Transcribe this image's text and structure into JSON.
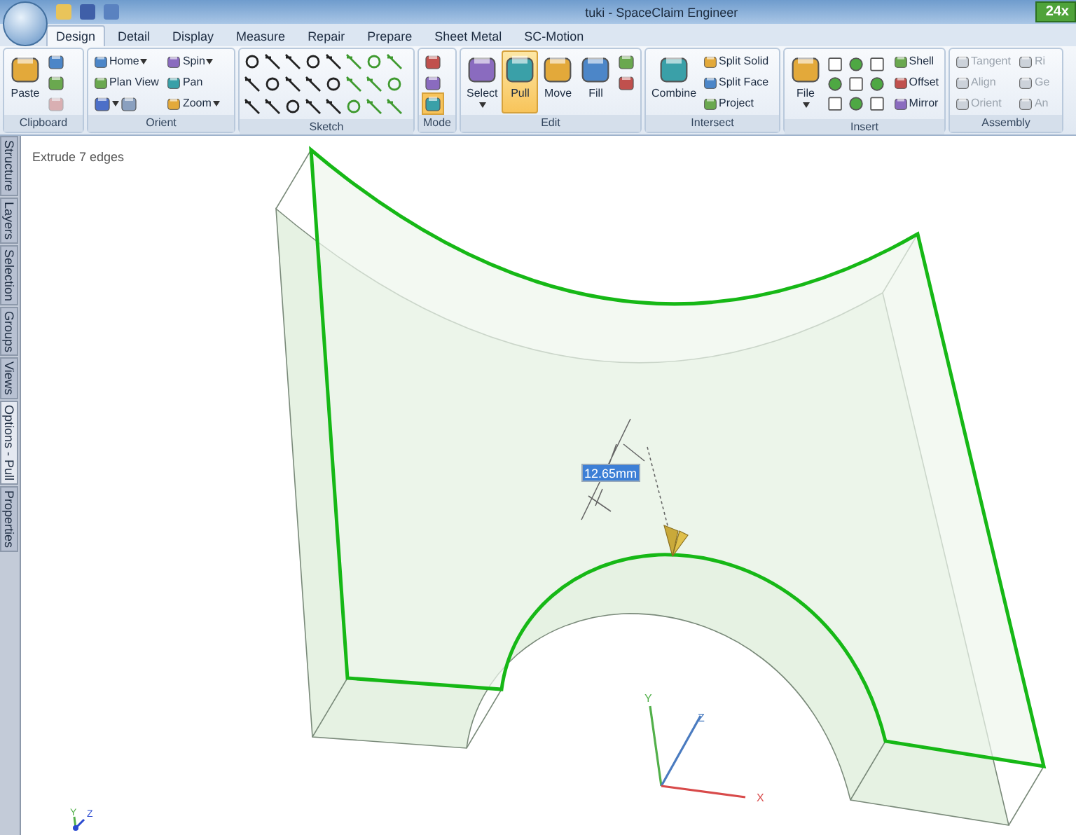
{
  "window": {
    "title": "tuki - SpaceClaim Engineer",
    "badge": "24x"
  },
  "tabs": [
    {
      "label": "Design",
      "selected": true
    },
    {
      "label": "Detail",
      "selected": false
    },
    {
      "label": "Display",
      "selected": false
    },
    {
      "label": "Measure",
      "selected": false
    },
    {
      "label": "Repair",
      "selected": false
    },
    {
      "label": "Prepare",
      "selected": false
    },
    {
      "label": "Sheet Metal",
      "selected": false
    },
    {
      "label": "SC-Motion",
      "selected": false
    }
  ],
  "ribbon_groups": [
    {
      "label": "Clipboard",
      "items": [
        {
          "kind": "large",
          "label": "Paste",
          "caret": false,
          "selected": false,
          "disabled": false
        },
        {
          "kind": "icon",
          "selected": false,
          "disabled": false
        },
        {
          "kind": "icon",
          "selected": false,
          "disabled": false
        },
        {
          "kind": "icon",
          "selected": false,
          "disabled": true
        }
      ]
    },
    {
      "label": "Orient",
      "items": [
        {
          "kind": "small",
          "label": "Home",
          "caret": true,
          "selected": false,
          "disabled": false
        },
        {
          "kind": "small",
          "label": "Plan View",
          "caret": false,
          "selected": false,
          "disabled": false
        },
        {
          "kind": "pair",
          "selected": false,
          "disabled": false
        },
        {
          "kind": "small",
          "label": "Spin",
          "caret": true,
          "selected": false,
          "disabled": false
        },
        {
          "kind": "small",
          "label": "Pan",
          "caret": false,
          "selected": false,
          "disabled": false
        },
        {
          "kind": "small",
          "label": "Zoom",
          "caret": true,
          "selected": false,
          "disabled": false
        }
      ]
    },
    {
      "label": "Sketch",
      "items": [
        {
          "kind": "sketch"
        }
      ]
    },
    {
      "label": "Mode",
      "items": [
        {
          "kind": "icon",
          "selected": false,
          "disabled": false
        },
        {
          "kind": "icon",
          "selected": false,
          "disabled": false
        },
        {
          "kind": "icon",
          "selected": true,
          "disabled": false
        }
      ]
    },
    {
      "label": "Edit",
      "items": [
        {
          "kind": "large",
          "label": "Select",
          "caret": true,
          "selected": false,
          "disabled": false
        },
        {
          "kind": "large",
          "label": "Pull",
          "caret": false,
          "selected": true,
          "disabled": false
        },
        {
          "kind": "large",
          "label": "Move",
          "caret": false,
          "selected": false,
          "disabled": false
        },
        {
          "kind": "large",
          "label": "Fill",
          "caret": false,
          "selected": false,
          "disabled": false
        },
        {
          "kind": "icon",
          "selected": false,
          "disabled": false
        },
        {
          "kind": "icon",
          "selected": false,
          "disabled": false
        }
      ]
    },
    {
      "label": "Intersect",
      "items": [
        {
          "kind": "large",
          "label": "Combine",
          "caret": false,
          "selected": false,
          "disabled": false
        },
        {
          "kind": "small",
          "label": "Split Solid",
          "caret": false,
          "selected": false,
          "disabled": false
        },
        {
          "kind": "small",
          "label": "Split Face",
          "caret": false,
          "selected": false,
          "disabled": false
        },
        {
          "kind": "small",
          "label": "Project",
          "caret": false,
          "selected": false,
          "disabled": false
        }
      ]
    },
    {
      "label": "Insert",
      "items": [
        {
          "kind": "large",
          "label": "File",
          "caret": true,
          "selected": false,
          "disabled": false
        },
        {
          "kind": "grid"
        },
        {
          "kind": "small",
          "label": "Shell",
          "caret": false,
          "selected": false,
          "disabled": false
        },
        {
          "kind": "small",
          "label": "Offset",
          "caret": false,
          "selected": false,
          "disabled": false
        },
        {
          "kind": "small",
          "label": "Mirror",
          "caret": false,
          "selected": false,
          "disabled": false
        }
      ]
    },
    {
      "label": "Assembly",
      "items": [
        {
          "kind": "small",
          "label": "Tangent",
          "caret": false,
          "selected": false,
          "disabled": true
        },
        {
          "kind": "small",
          "label": "Align",
          "caret": false,
          "selected": false,
          "disabled": true
        },
        {
          "kind": "small",
          "label": "Orient",
          "caret": false,
          "selected": false,
          "disabled": true
        },
        {
          "kind": "small",
          "label": "Ri",
          "caret": false,
          "selected": false,
          "disabled": true
        },
        {
          "kind": "small",
          "label": "Ge",
          "caret": false,
          "selected": false,
          "disabled": true
        },
        {
          "kind": "small",
          "label": "An",
          "caret": false,
          "selected": false,
          "disabled": true
        }
      ]
    }
  ],
  "side_tabs": [
    {
      "label": "Structure",
      "selected": false
    },
    {
      "label": "Layers",
      "selected": false
    },
    {
      "label": "Selection",
      "selected": false
    },
    {
      "label": "Groups",
      "selected": false
    },
    {
      "label": "Views",
      "selected": false
    },
    {
      "label": "Options - Pull",
      "selected": true
    },
    {
      "label": "Properties",
      "selected": false
    }
  ],
  "viewport": {
    "status": "Extrude 7 edges",
    "dimension": "12.65mm",
    "axes": {
      "x": "X",
      "y": "Y",
      "z": "Z"
    },
    "mini_axes": {
      "y": "Y",
      "z": "Z"
    }
  }
}
